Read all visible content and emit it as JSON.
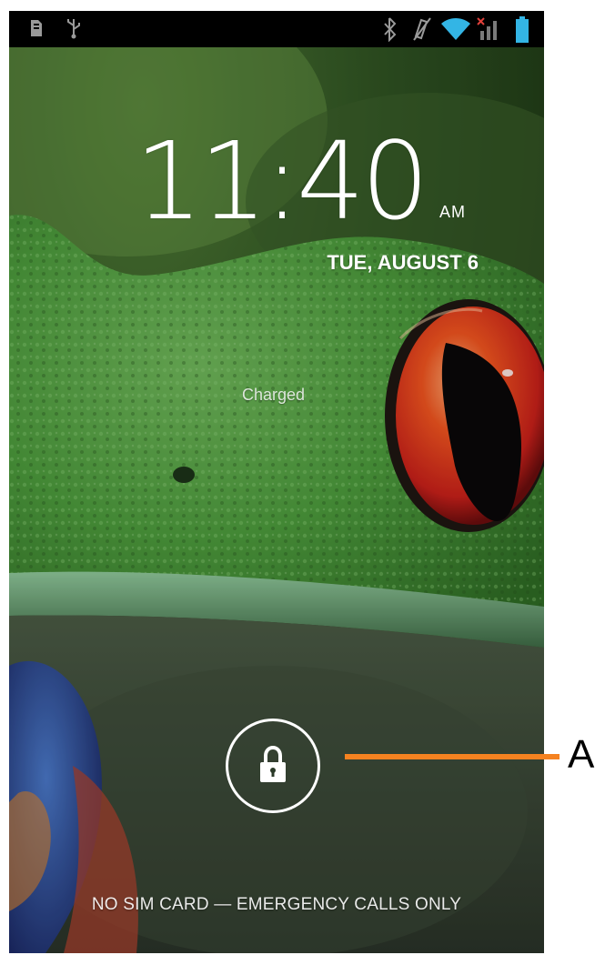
{
  "status_bar": {
    "left_icons": [
      "sd-card-icon",
      "usb-icon"
    ],
    "right_icons": [
      "bluetooth-icon",
      "vibrate-icon",
      "wifi-icon",
      "no-signal-icon",
      "battery-icon"
    ]
  },
  "lock_screen": {
    "time": "11:40",
    "ampm": "AM",
    "date": "TUE, AUGUST 6",
    "battery_status": "Charged",
    "unlock_icon": "lock-icon",
    "emergency_text": "NO SIM CARD — EMERGENCY CALLS ONLY"
  },
  "annotation": {
    "label": "A",
    "color": "#f58220"
  }
}
